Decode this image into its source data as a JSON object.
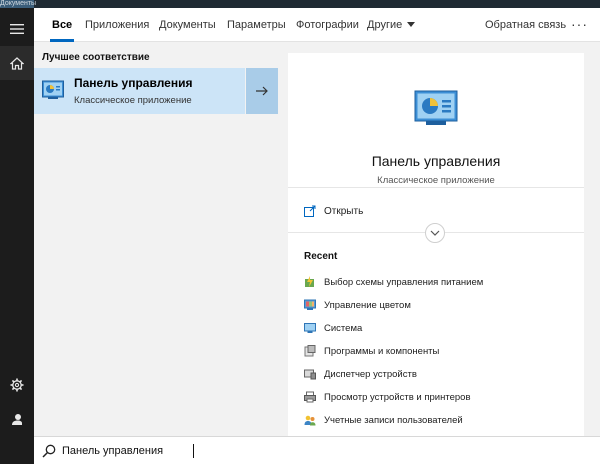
{
  "desktop": {
    "label": "Документы"
  },
  "tabs": [
    {
      "label": "Все",
      "active": true
    },
    {
      "label": "Приложения",
      "active": false
    },
    {
      "label": "Документы",
      "active": false
    },
    {
      "label": "Параметры",
      "active": false
    },
    {
      "label": "Фотографии",
      "active": false
    },
    {
      "label": "Другие",
      "active": false
    }
  ],
  "feedback_label": "Обратная связь",
  "more_label": "···",
  "best_match": {
    "heading": "Лучшее соответствие",
    "title": "Панель управления",
    "subtitle": "Классическое приложение",
    "icon": "control-panel-icon"
  },
  "preview": {
    "title": "Панель управления",
    "subtitle": "Классическое приложение",
    "open_label": "Открыть",
    "recent_heading": "Recent",
    "recent": [
      {
        "label": "Выбор схемы управления питанием",
        "icon": "power-options-icon"
      },
      {
        "label": "Управление цветом",
        "icon": "color-management-icon"
      },
      {
        "label": "Система",
        "icon": "system-icon"
      },
      {
        "label": "Программы и компоненты",
        "icon": "programs-icon"
      },
      {
        "label": "Диспетчер устройств",
        "icon": "device-manager-icon"
      },
      {
        "label": "Просмотр устройств и принтеров",
        "icon": "printers-icon"
      },
      {
        "label": "Учетные записи пользователей",
        "icon": "user-accounts-icon"
      }
    ]
  },
  "search": {
    "value": "Панель управления"
  },
  "colors": {
    "accent": "#0067c0",
    "highlight": "#cce4f7",
    "rail": "#1c1c1c"
  }
}
